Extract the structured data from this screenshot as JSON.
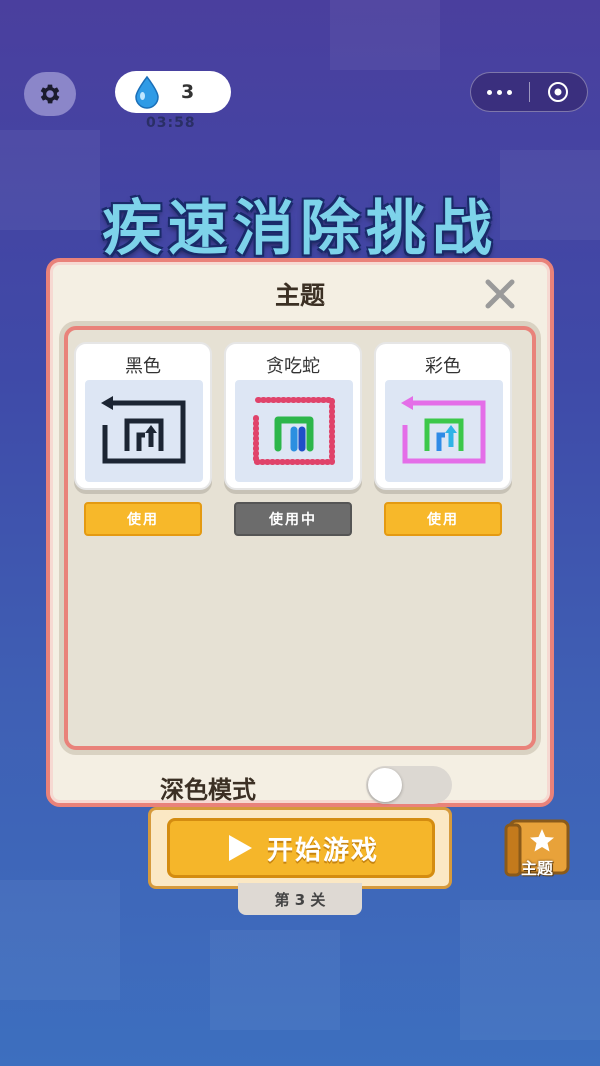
{
  "top_bar": {
    "drops_count": "3",
    "timer": "03:58",
    "gear_icon": "gear-icon",
    "drop_icon": "water-drop-icon",
    "more_icon": "more-icon",
    "record_icon": "record-icon"
  },
  "game_title": "疾速消除挑战",
  "theme_modal": {
    "title": "主题",
    "themes": [
      {
        "label": "黑色",
        "button": "使用",
        "in_use": false
      },
      {
        "label": "贪吃蛇",
        "button": "使用中",
        "in_use": true
      },
      {
        "label": "彩色",
        "button": "使用",
        "in_use": false
      }
    ],
    "dark_mode_label": "深色模式",
    "dark_mode_on": false
  },
  "start_button": "开始游戏",
  "level_label": "第 3 关",
  "theme_button_label": "主题",
  "colors": {
    "accent_orange": "#f5b62a",
    "modal_border": "#e9827a",
    "title_cyan": "#7dd3ea"
  }
}
